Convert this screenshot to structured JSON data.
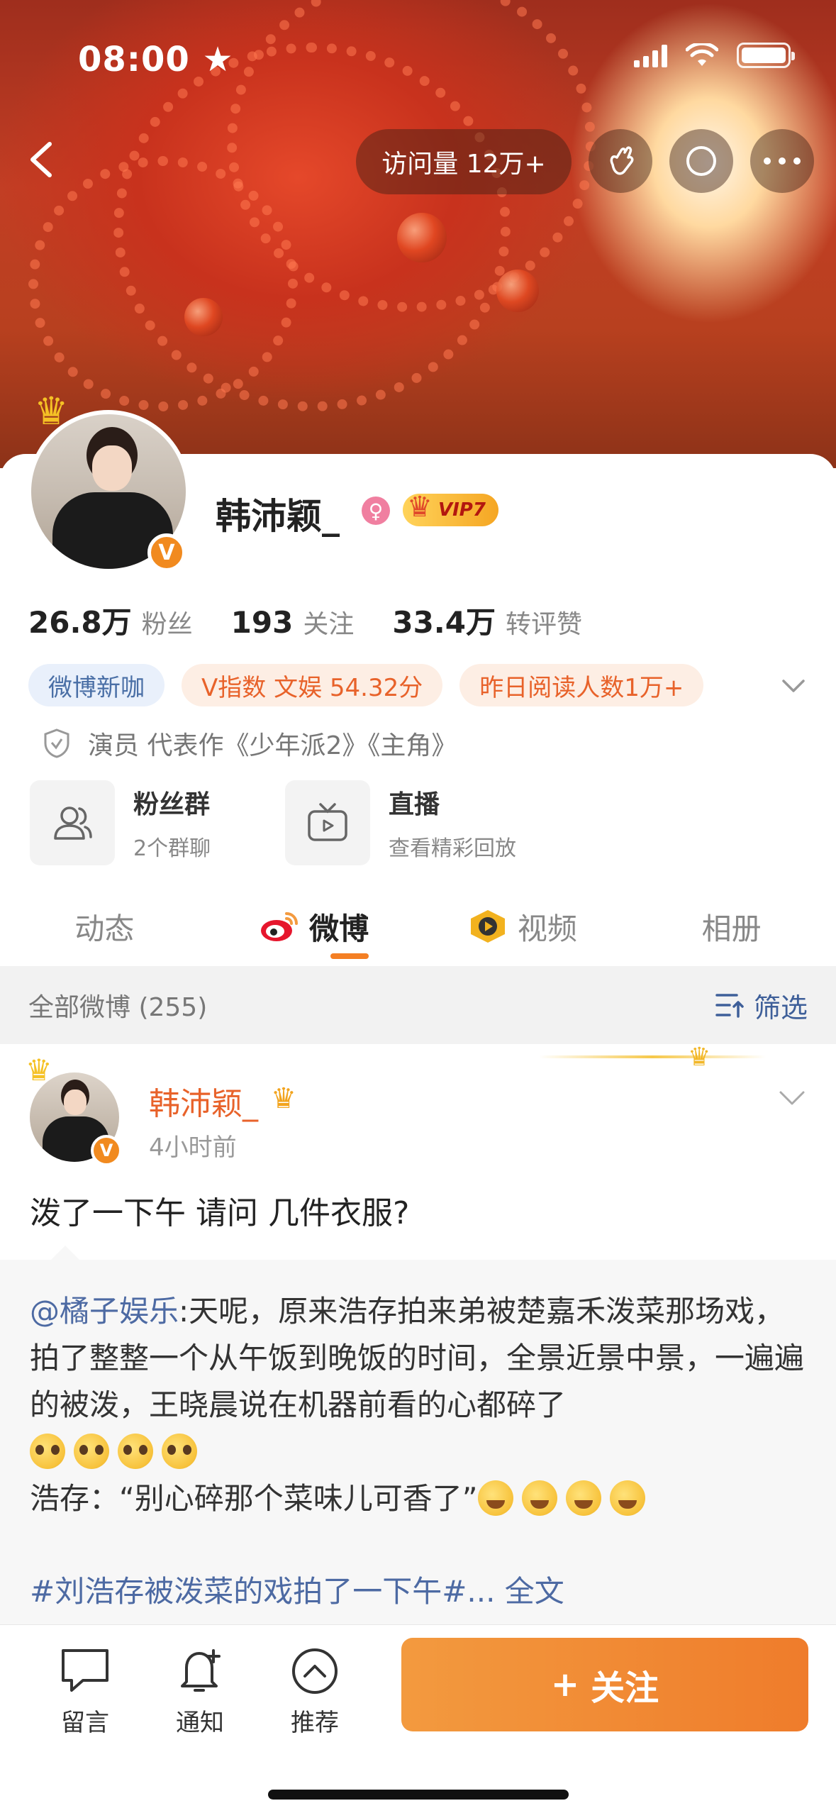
{
  "status_bar": {
    "time": "08:00"
  },
  "header": {
    "visits": "访问量 12万+"
  },
  "profile": {
    "name": "韩沛颖_",
    "vip": "VIP7",
    "stats": [
      {
        "value": "26.8万",
        "label": "粉丝"
      },
      {
        "value": "193",
        "label": "关注"
      },
      {
        "value": "33.4万",
        "label": "转评赞"
      }
    ],
    "tags": [
      "微博新咖",
      "V指数 文娱 54.32分",
      "昨日阅读人数1万+"
    ],
    "description": "演员 代表作《少年派2》《主角》",
    "features": [
      {
        "title": "粉丝群",
        "sub": "2个群聊"
      },
      {
        "title": "直播",
        "sub": "查看精彩回放"
      }
    ]
  },
  "tabs": [
    "动态",
    "微博",
    "视频",
    "相册"
  ],
  "filter": {
    "label": "全部微博 (255)",
    "action": "筛选"
  },
  "post": {
    "author": "韩沛颖_",
    "time": "4小时前",
    "text": "泼了一下午 请问 几件衣服?",
    "repost": {
      "mention": "@橘子娱乐",
      "body": ":天呢，原来浩存拍来弟被楚嘉禾泼菜那场戏，拍了整整一个从午饭到晚饭的时间，全景近景中景，一遍遍的被泼，王晓晨说在机器前看的心都碎了",
      "line2": "浩存：“别心碎那个菜味儿可香了”",
      "hashtag": "#刘浩存被泼菜的戏拍了一下午#...",
      "full": "全文"
    }
  },
  "bottom": {
    "actions": [
      "留言",
      "通知",
      "推荐"
    ],
    "follow": "关注",
    "follow_plus": "+"
  },
  "colors": {
    "accent": "#ef7c2b",
    "link": "#4d6aa3",
    "name_orange": "#e8622a"
  }
}
